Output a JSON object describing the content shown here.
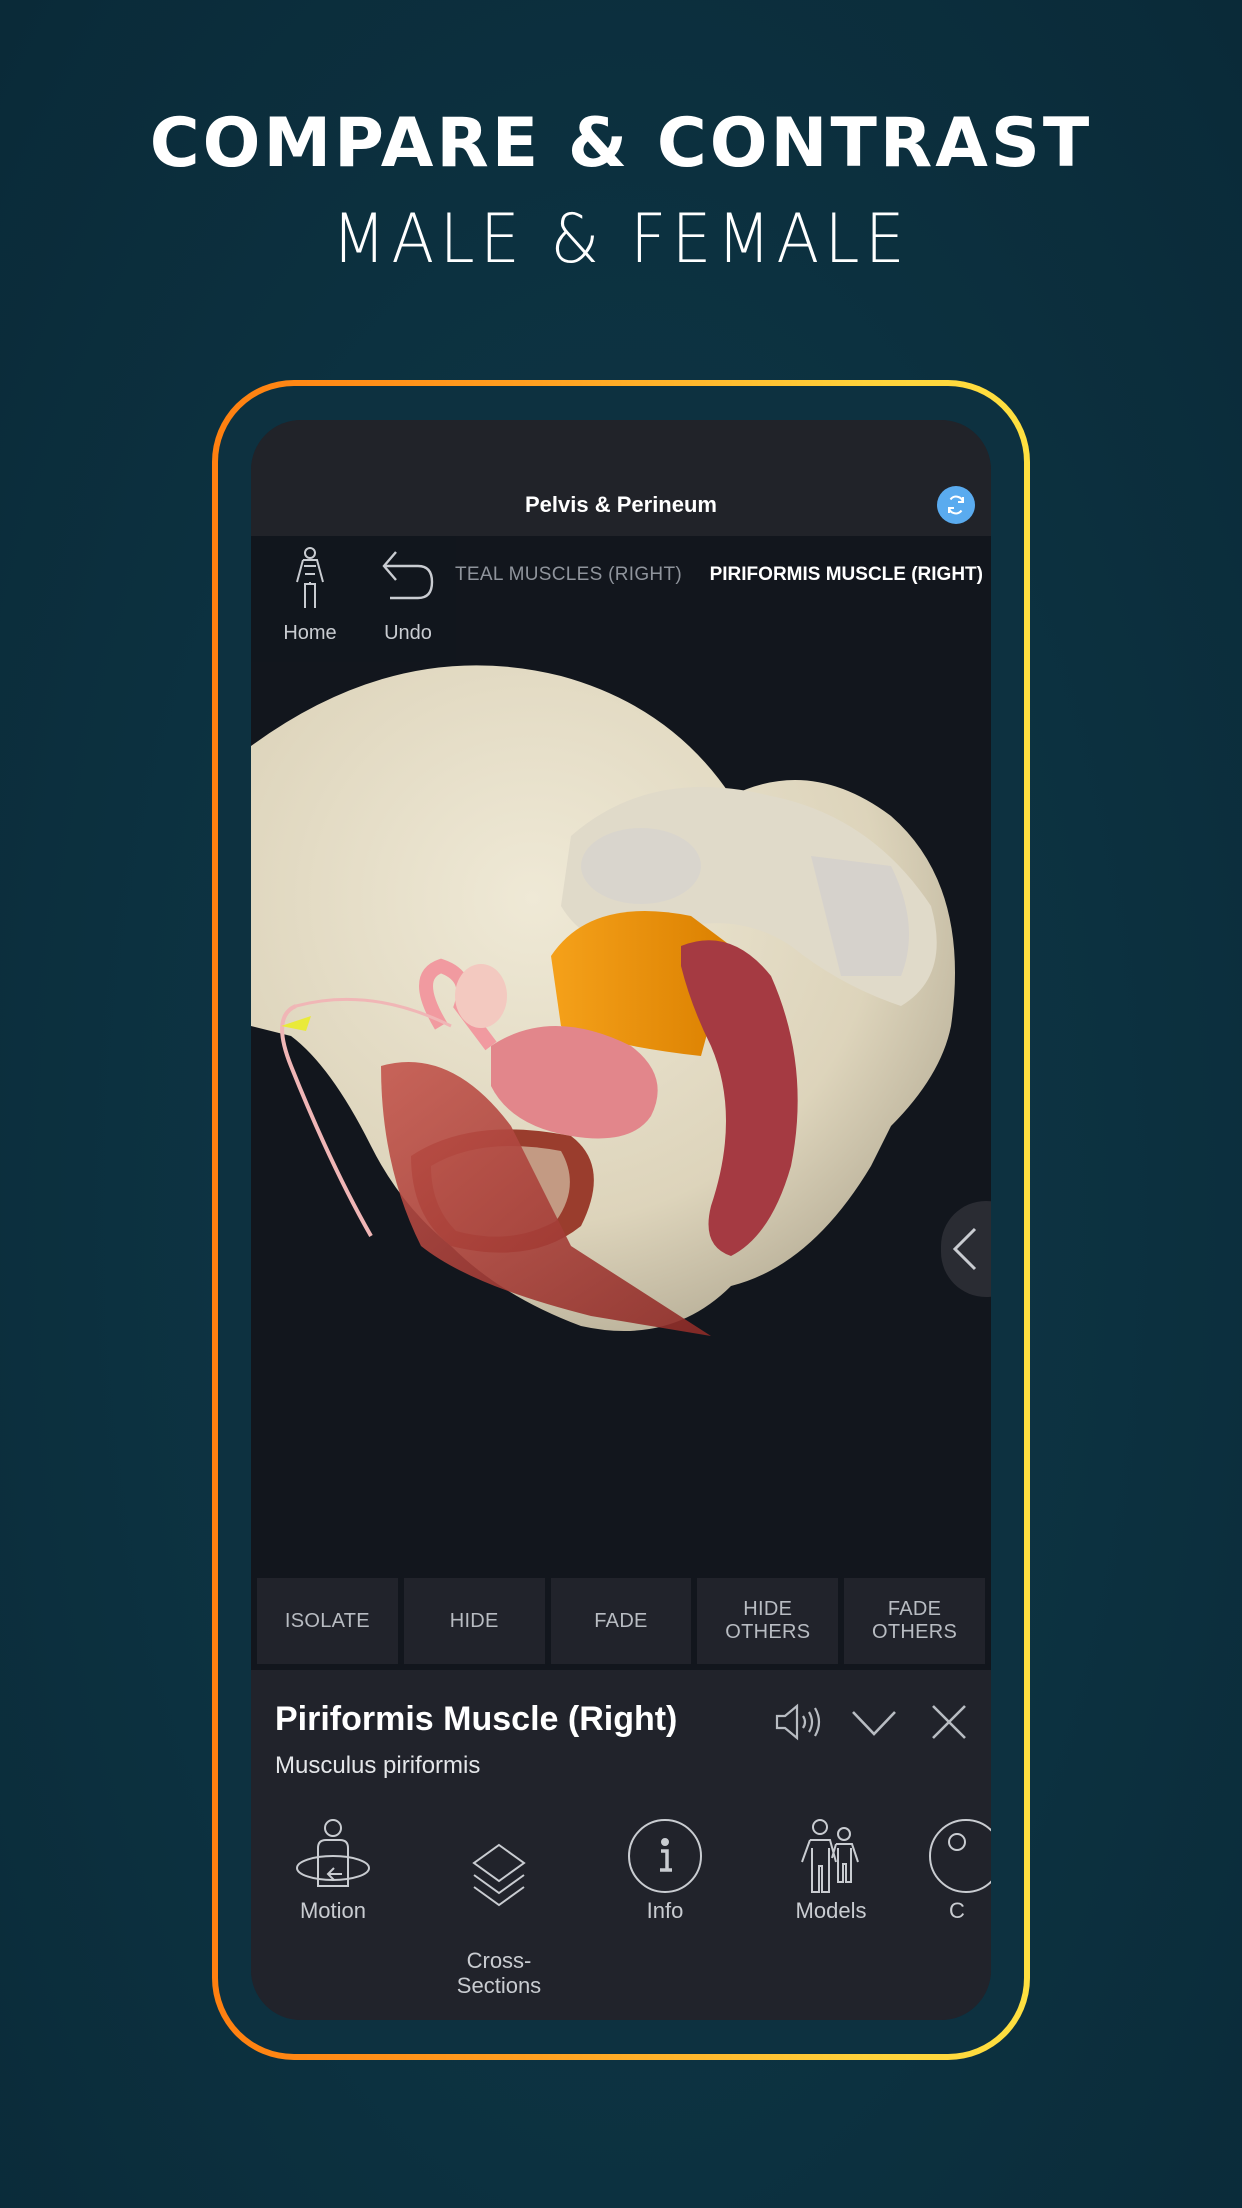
{
  "promo": {
    "headline": "COMPARE & CONTRAST",
    "subhead": "MALE & FEMALE"
  },
  "colors": {
    "background": "#0d3342",
    "frame_gradient_start": "#ff7f10",
    "frame_gradient_end": "#ffe040",
    "sync_button": "#5aabef",
    "panel": "#21232b"
  },
  "app": {
    "title": "Pelvis & Perineum",
    "sync_icon": "sync-icon",
    "tools": [
      {
        "label": "Home",
        "icon": "human-figure-icon"
      },
      {
        "label": "Undo",
        "icon": "undo-arrow-icon"
      }
    ],
    "breadcrumb": {
      "previous": "TEAL MUSCLES (RIGHT)",
      "current": "PIRIFORMIS MUSCLE (RIGHT)"
    },
    "side_toggle_icon": "chevron-left-icon",
    "actions": [
      {
        "label": "ISOLATE"
      },
      {
        "label": "HIDE"
      },
      {
        "label": "FADE"
      },
      {
        "label": "HIDE\nOTHERS"
      },
      {
        "label": "FADE\nOTHERS"
      }
    ],
    "structure": {
      "name": "Piriformis Muscle (Right)",
      "latin": "Musculus piriformis",
      "icons": [
        "speaker-icon",
        "chevron-down-icon",
        "close-icon"
      ]
    },
    "bottom_nav": [
      {
        "label": "Motion",
        "icon": "motion-icon"
      },
      {
        "label": "Cross-\nSections",
        "icon": "layers-icon"
      },
      {
        "label": "Info",
        "icon": "info-icon"
      },
      {
        "label": "Models",
        "icon": "models-icon"
      },
      {
        "label": "C",
        "icon": "circle-icon"
      }
    ]
  }
}
